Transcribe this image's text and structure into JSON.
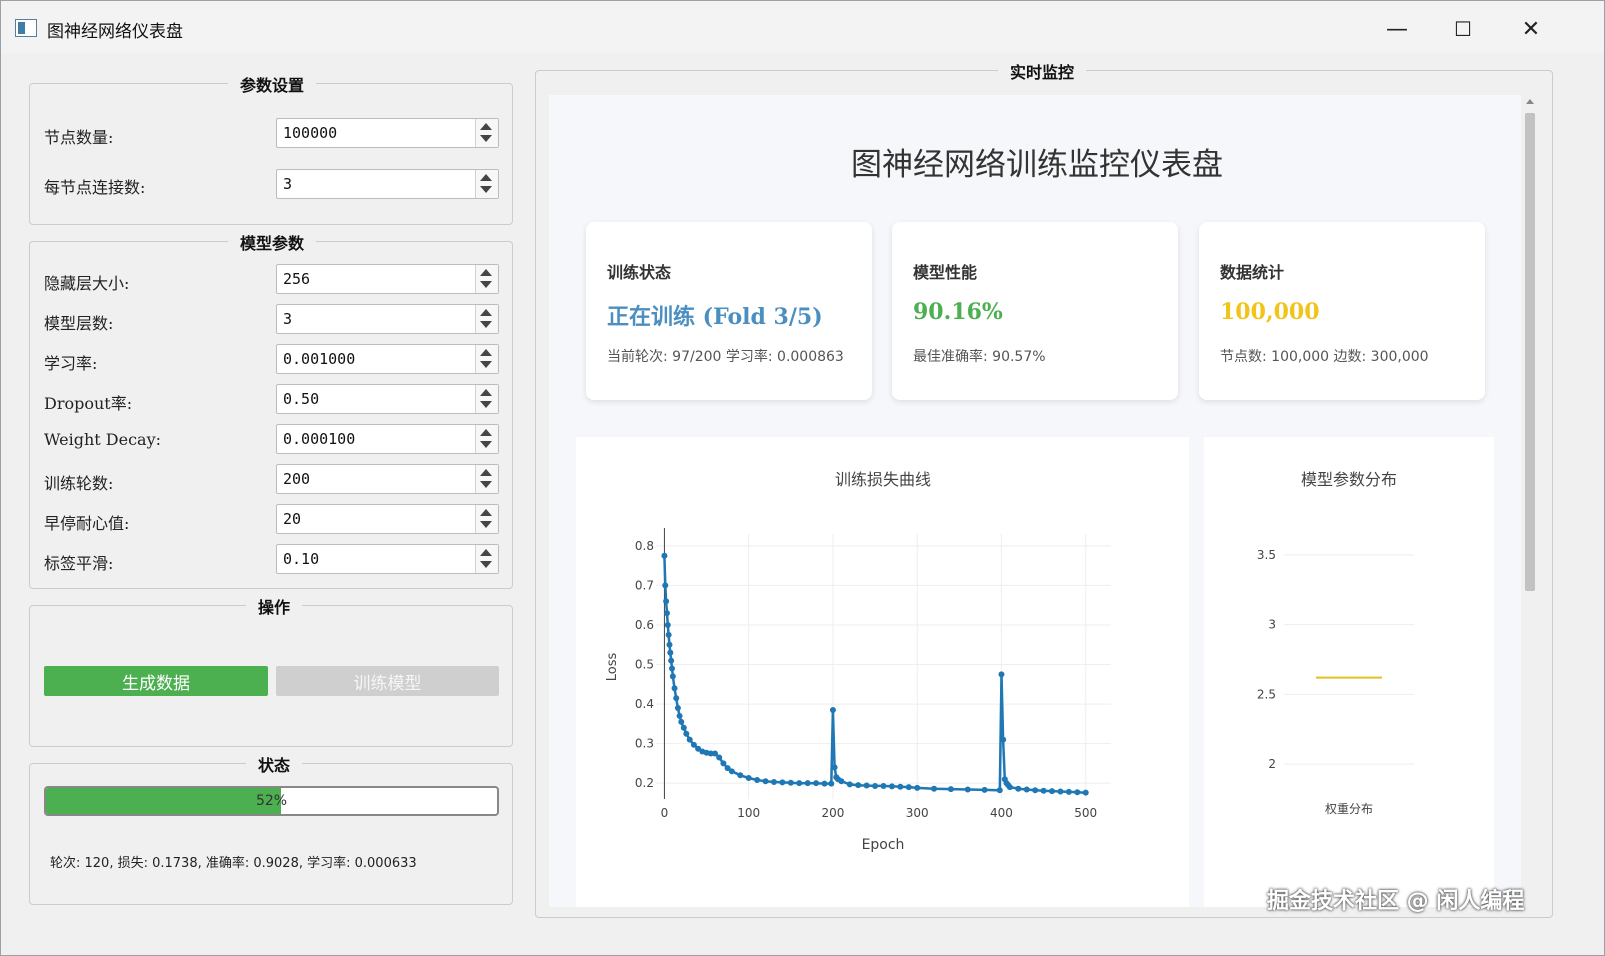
{
  "window": {
    "title": "图神经网络仪表盘",
    "controls": {
      "minimize": "—",
      "maximize": "☐",
      "close": "✕"
    }
  },
  "params_group": {
    "title": "参数设置",
    "fields": [
      {
        "label": "节点数量:",
        "value": "100000"
      },
      {
        "label": "每节点连接数:",
        "value": "3"
      }
    ]
  },
  "model_group": {
    "title": "模型参数",
    "fields": [
      {
        "label": "隐藏层大小:",
        "value": "256"
      },
      {
        "label": "模型层数:",
        "value": "3"
      },
      {
        "label": "学习率:",
        "value": "0.001000"
      },
      {
        "label": "Dropout率:",
        "value": "0.50"
      },
      {
        "label": "Weight Decay:",
        "value": "0.000100"
      },
      {
        "label": "训练轮数:",
        "value": "200"
      },
      {
        "label": "早停耐心值:",
        "value": "20"
      },
      {
        "label": "标签平滑:",
        "value": "0.10"
      }
    ]
  },
  "ops_group": {
    "title": "操作",
    "generate_label": "生成数据",
    "train_label": "训练模型"
  },
  "status_group": {
    "title": "状态",
    "progress_percent": 52,
    "progress_text": "52%",
    "status_text": "轮次: 120, 损失: 0.1738, 准确率: 0.9028, 学习率: 0.000633"
  },
  "monitor": {
    "title": "实时监控",
    "dashboard_title": "图神经网络训练监控仪表盘",
    "cards": [
      {
        "title": "训练状态",
        "value": "正在训练 (Fold 3/5)",
        "sub": "当前轮次: 97/200 学习率: 0.000863",
        "color": "#4a8fc0"
      },
      {
        "title": "模型性能",
        "value": "90.16%",
        "sub": "最佳准确率: 90.57%",
        "color": "#4caf50"
      },
      {
        "title": "数据统计",
        "value": "100,000",
        "sub": "节点数: 100,000 边数: 300,000",
        "color": "#f0c419"
      }
    ]
  },
  "chart_data": [
    {
      "type": "line",
      "title": "训练损失曲线",
      "xlabel": "Epoch",
      "ylabel": "Loss",
      "xlim": [
        -10,
        530
      ],
      "ylim": [
        0.16,
        0.83
      ],
      "xticks": [
        0,
        100,
        200,
        300,
        400,
        500
      ],
      "yticks": [
        0.2,
        0.3,
        0.4,
        0.5,
        0.6,
        0.7,
        0.8
      ],
      "grid": true,
      "color": "#1f77b4",
      "x": [
        0,
        1,
        2,
        3,
        4,
        5,
        6,
        7,
        8,
        9,
        10,
        12,
        14,
        16,
        18,
        20,
        23,
        26,
        30,
        35,
        40,
        45,
        50,
        55,
        60,
        65,
        70,
        75,
        80,
        90,
        100,
        110,
        120,
        130,
        140,
        150,
        160,
        170,
        180,
        190,
        198,
        200,
        202,
        204,
        206,
        210,
        220,
        230,
        240,
        250,
        260,
        270,
        280,
        290,
        300,
        320,
        340,
        360,
        380,
        398,
        400,
        402,
        404,
        406,
        408,
        410,
        420,
        430,
        440,
        450,
        460,
        470,
        480,
        490,
        500
      ],
      "y": [
        0.775,
        0.7,
        0.66,
        0.63,
        0.6,
        0.575,
        0.55,
        0.53,
        0.51,
        0.49,
        0.47,
        0.44,
        0.415,
        0.39,
        0.37,
        0.355,
        0.34,
        0.325,
        0.31,
        0.297,
        0.287,
        0.28,
        0.277,
        0.275,
        0.275,
        0.265,
        0.25,
        0.238,
        0.23,
        0.22,
        0.213,
        0.208,
        0.205,
        0.203,
        0.202,
        0.201,
        0.2,
        0.2,
        0.2,
        0.199,
        0.199,
        0.385,
        0.24,
        0.215,
        0.21,
        0.205,
        0.197,
        0.195,
        0.194,
        0.193,
        0.193,
        0.192,
        0.191,
        0.19,
        0.188,
        0.186,
        0.185,
        0.184,
        0.183,
        0.182,
        0.475,
        0.31,
        0.21,
        0.2,
        0.195,
        0.19,
        0.186,
        0.184,
        0.182,
        0.181,
        0.18,
        0.179,
        0.178,
        0.177,
        0.176
      ]
    },
    {
      "type": "box",
      "title": "模型参数分布",
      "categories": [
        "权重分布"
      ],
      "values": [
        2.62
      ],
      "ylim": [
        1.75,
        3.65
      ],
      "yticks": [
        2,
        2.5,
        3,
        3.5
      ],
      "yticklabels": [
        "2",
        "2.5",
        "3",
        "3.5"
      ],
      "grid": true,
      "color": "#e0c020"
    }
  ],
  "watermark": "掘金技术社区 @ 闲人编程"
}
